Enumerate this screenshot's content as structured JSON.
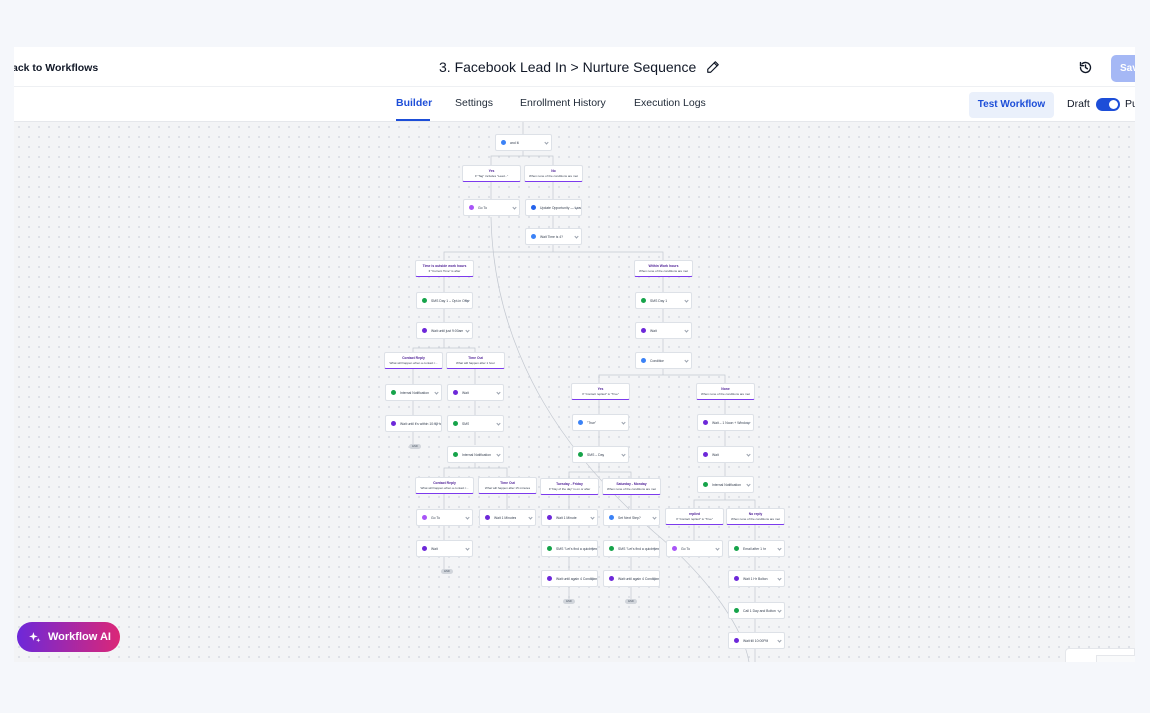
{
  "header": {
    "back_label": "ack to Workflows",
    "workflow_title": "3. Facebook Lead In > Nurture Sequence",
    "save_label": "Save"
  },
  "tabs": [
    {
      "label": "Builder",
      "active": true
    },
    {
      "label": "Settings",
      "active": false
    },
    {
      "label": "Enrollment History",
      "active": false
    },
    {
      "label": "Execution Logs",
      "active": false
    }
  ],
  "toolbar": {
    "test_label": "Test Workflow",
    "draft_label": "Draft",
    "publish_label": "Pu",
    "published": true
  },
  "ai_button": {
    "label": "Workflow AI"
  },
  "colors": {
    "accent": "#1d4ed8",
    "branch_purple": "#7c3aed",
    "sms_green": "#16a34a",
    "wait_purple": "#6d28d9",
    "condition_blue": "#3b82f6"
  },
  "icons": {
    "pencil": "pencil-icon",
    "history": "history-icon",
    "sparkle": "sparkle-icon"
  },
  "canvas": {
    "nodes": [
      {
        "label": "and If/",
        "color": "#3b82f6"
      },
      {
        "label": "Go To",
        "color": "#a855f7"
      },
      {
        "label": "Update Opportunity — Lead got replied",
        "color": "#2563eb"
      },
      {
        "label": "Wait Time is 4?",
        "color": "#3b82f6"
      },
      {
        "label": "SMS Day 1 – Opt-in Offer",
        "color": "#16a34a"
      },
      {
        "label": "Wait until just 9:00am",
        "color": "#6d28d9"
      },
      {
        "label": "SMS Day 1",
        "color": "#16a34a"
      },
      {
        "label": "Wait",
        "color": "#6d28d9"
      },
      {
        "label": "Condition",
        "color": "#3b82f6"
      },
      {
        "label": "Internal Notification",
        "color": "#16a34a"
      },
      {
        "label": "Wait until it's within 10:00 hours",
        "color": "#6d28d9"
      },
      {
        "label": "Wait",
        "color": "#6d28d9"
      },
      {
        "label": "SMS",
        "color": "#16a34a"
      },
      {
        "label": "Internal Notification",
        "color": "#16a34a"
      },
      {
        "label": "\"True\"",
        "color": "#3b82f6"
      },
      {
        "label": "SMS – Day",
        "color": "#16a34a"
      },
      {
        "label": "Wait – 1 Noon + Window",
        "color": "#6d28d9"
      },
      {
        "label": "Wait",
        "color": "#6d28d9"
      },
      {
        "label": "Internal Notification",
        "color": "#16a34a"
      },
      {
        "label": "Go To",
        "color": "#a855f7"
      },
      {
        "label": "Wait 1 Minutes",
        "color": "#6d28d9"
      },
      {
        "label": "Wait 1 Minute",
        "color": "#6d28d9"
      },
      {
        "label": "Set Next Step?",
        "color": "#3b82f6"
      },
      {
        "label": "Wait",
        "color": "#6d28d9"
      },
      {
        "label": "SMS \"Let's find a quick time\"",
        "color": "#16a34a"
      },
      {
        "label": "SMS \"Let's find a quick time\"",
        "color": "#16a34a"
      },
      {
        "label": "Go To",
        "color": "#a855f7"
      },
      {
        "label": "Email after 1 hr",
        "color": "#16a34a"
      },
      {
        "label": "Wait until again 4 Condition",
        "color": "#6d28d9"
      },
      {
        "label": "Wait until again 4 Condition",
        "color": "#6d28d9"
      },
      {
        "label": "Wait 1 Hr Bolton",
        "color": "#6d28d9"
      },
      {
        "label": "Call 1 Day and Bolton",
        "color": "#16a34a"
      },
      {
        "label": "Wait till 10:00PM",
        "color": "#6d28d9"
      }
    ],
    "branches": [
      {
        "title": "Yes",
        "sub": "If \"Tag\" includes \"Lead...\""
      },
      {
        "title": "No",
        "sub": "When none of the conditions are met"
      },
      {
        "title": "Time is outside work hours",
        "sub": "If \"Current Time\" is after"
      },
      {
        "title": "Within Work hours",
        "sub": "When none of the conditions are met"
      },
      {
        "title": "Contact Reply",
        "sub": "What will happen when a contact r..."
      },
      {
        "title": "Time Out",
        "sub": "What will happen after 1 hour"
      },
      {
        "title": "Yes",
        "sub": "If \"Contact replied\" is \"True\""
      },
      {
        "title": "None",
        "sub": "When none of the conditions are met"
      },
      {
        "title": "Contact Reply",
        "sub": "What will happen when a contact r..."
      },
      {
        "title": "Time Out",
        "sub": "What will happen after 15 minutes"
      },
      {
        "title": "Tuesday - Friday",
        "sub": "If \"Day of the day\" is on or after"
      },
      {
        "title": "Saturday - Monday",
        "sub": "When none of the conditions are met"
      },
      {
        "title": "replied",
        "sub": "If \"Contact replied\" is \"True\""
      },
      {
        "title": "No reply",
        "sub": "When none of the conditions are met"
      }
    ],
    "end_label": "END"
  }
}
